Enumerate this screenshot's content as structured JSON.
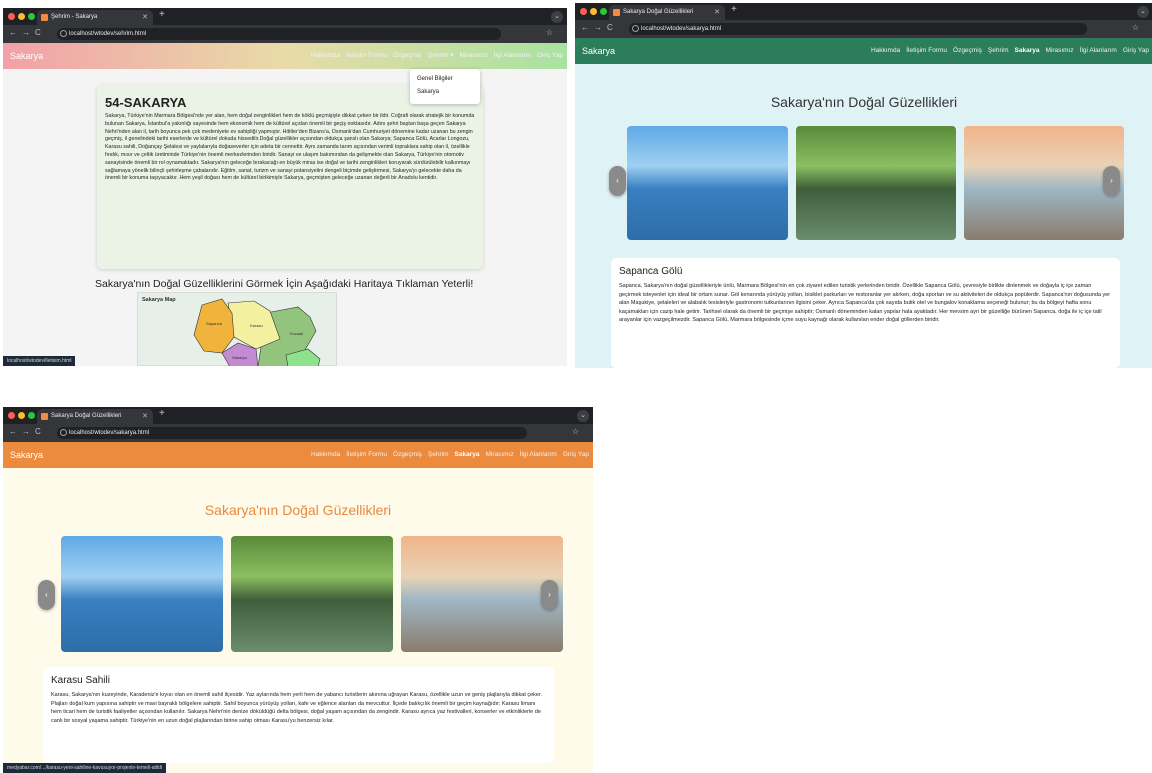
{
  "win1": {
    "tab_title": "Şehrim - Sakarya",
    "url": "localhost/wtodev/sehrim.html",
    "brand": "Sakarya",
    "menu": [
      "Hakkımda",
      "İletişim Formu",
      "Özgeçmiş",
      "Şehrim ▾",
      "Mirasımız",
      "İlgi Alanlarım",
      "Giriş Yap"
    ],
    "dropdown": [
      "Genel Bilgiler",
      "Sakarya"
    ],
    "heading": "54-SAKARYA",
    "paragraph": "Sakarya, Türkiye'nin Marmara Bölgesi'nde yer alan, hem doğal zenginlikleri hem de köklü geçmişiyle dikkat çeken bir ildir. Coğrafi olarak stratejik bir konumda bulunan Sakarya, İstanbul'a yakınlığı sayesinde hem ekonomik hem de kültürel açıdan önemli bir geçiş noktasıdır. Adını şehri baştan başa geçen Sakarya Nehri'nden alan il, tarih boyunca pek çok medeniyete ev sahipliği yapmıştır. Hititler'den Bizans'a, Osmanlı'dan Cumhuriyet dönemine kadar uzanan bu zengin geçmiş, il genelindeki tarihi eserlerde ve kültürel dokuda hissedilir.Doğal güzellikler açısından oldukça şanslı olan Sakarya; Sapanca Gölü, Acarlar Longozu, Karasu sahili, Doğançay Şelalesi ve yaylalarıyla doğaseverler için adeta bir cennettir. Aynı zamanda tarım açısından verimli topraklara sahip olan il, özellikle fındık, mısır ve çeltik üretiminde Türkiye'nin önemli merkezlerinden biridir. Sanayi ve ulaşım bakımından da gelişmekte olan Sakarya, Türkiye'nin otomotiv sanayisinde önemli bir rol oynamaktadır. Sakarya'nın geleceğe bırakacağı en büyük miras ise doğal ve tarihi zenginlikleri koruyarak sürdürülebilir kalkınmayı sağlamaya yönelik bilinçli şehirleşme çabalarıdır. Eğitim, sanat, turizm ve sanayi potansiyelini dengeli biçimde geliştirmesi, Sakarya'yı gelecekte daha da önemli bir konuma taşıyacaktır. Hem yeşil doğası hem de kültürel birikimiyle Sakarya, geçmişten geleceğe uzanan değerli bir Anadolu kentidir.",
    "map_heading": "Sakarya'nın Doğal Güzelliklerini Görmek İçin Aşağıdaki Haritaya Tıklaman Yeterli!",
    "map_label": "Sakarya Map",
    "map_regions": [
      "Sapanca",
      "Karasu",
      "Kocaali",
      "Sakarya"
    ],
    "status": "localhost/wtodev/iletisim.html"
  },
  "win2": {
    "tab_title": "Sakarya Doğal Güzellikleri",
    "url": "localhost/wtodev/sakarya.html",
    "brand": "Sakarya",
    "menu": [
      "Hakkımda",
      "İletişim Formu",
      "Özgeçmiş",
      "Şehrim",
      "Sakarya",
      "Mirasımız",
      "İlgi Alanlarım",
      "Giriş Yap"
    ],
    "title": "Sakarya'nın Doğal Güzellikleri",
    "card_title": "Sapanca Gölü",
    "card_text": "Sapanca, Sakarya'nın doğal güzellikleriyle ünlü, Marmara Bölgesi'nin en çok ziyaret edilen turistik yerlerinden biridir. Özellikle Sapanca Gölü, çevresiyle birlikte dinlenmek ve doğayla iç içe zaman geçirmek isteyenler için ideal bir ortam sunar. Göl kenarında yürüyüş yolları, bisiklet parkurları ve restoranlar yer alırken, doğa sporları ve su aktiviteleri de oldukça popülerdir. Sapanca'nın doğusunda yer alan Maşukiye, şelaleleri ve alabalık tesisleriyle gastronomi tutkunlarının ilgisini çeker. Ayrıca Sapanca'da çok sayıda butik otel ve bungalov konaklama seçeneği bulunur; bu da bölgeyi hafta sonu kaçamakları için cazip hale getirir. Tarihsel olarak da önemli bir geçmişe sahiptir; Osmanlı döneminden kalan yapılar hala ayaktadır. Her mevsim ayrı bir güzelliğe bürünen Sapanca, doğa ile iç içe tatil arayanlar için vazgeçilmezdir. Sapanca Gölü, Marmara bölgesinde içme suyu kaynağı olarak kullanılan ender doğal göllerden biridir."
  },
  "win3": {
    "tab_title": "Sakarya Doğal Güzellikleri",
    "url": "localhost/wtodev/sakarya.html",
    "brand": "Sakarya",
    "menu": [
      "Hakkımda",
      "İletişim Formu",
      "Özgeçmiş",
      "Şehrim",
      "Sakarya",
      "Mirasımız",
      "İlgi Alanlarım",
      "Giriş Yap"
    ],
    "title": "Sakarya'nın Doğal Güzellikleri",
    "card_title": "Karasu Sahili",
    "card_text": "Karasu, Sakarya'nın kuzeyinde, Karadeniz'e kıyısı olan en önemli sahil ilçesidir. Yaz aylarında hem yerli hem de yabancı turistlerin akınına uğrayan Karasu, özellikle uzun ve geniş plajlarıyla dikkat çeker. Plajları doğal kum yapısına sahiptir ve mavi bayraklı bölgelere sahiptir. Sahil boyunca yürüyüş yolları, kafe ve eğlence alanları da mevcuttur. İlçede balıkçılık önemli bir geçim kaynağıdır; Karasu limanı hem ticari hem de turistik faaliyetler açısından kullanılır. Sakarya Nehri'nin denize döküldüğü delta bölgesi, doğal yaşam açısından da zengindir. Karasu ayrıca yaz festivalleri, konserler ve etkinliklerle de canlı bir sosyal yaşama sahiptir. Türkiye'nin en uzun doğal plajlarından birine sahip olması Karasu'yu benzersiz kılar.",
    "status": "medyabar.com/.../karasu-yeni-sahiline-kavusuyor-projenin-temeli-atildi"
  },
  "icons": {
    "back": "←",
    "forward": "→",
    "reload": "C",
    "prev": "‹",
    "next": "›",
    "star": "☆"
  },
  "colors": {
    "green_nav": "#2c7d5a",
    "orange_nav": "#ec8a3e",
    "orange_title": "#e7893e",
    "pastel_nav": "linear"
  }
}
